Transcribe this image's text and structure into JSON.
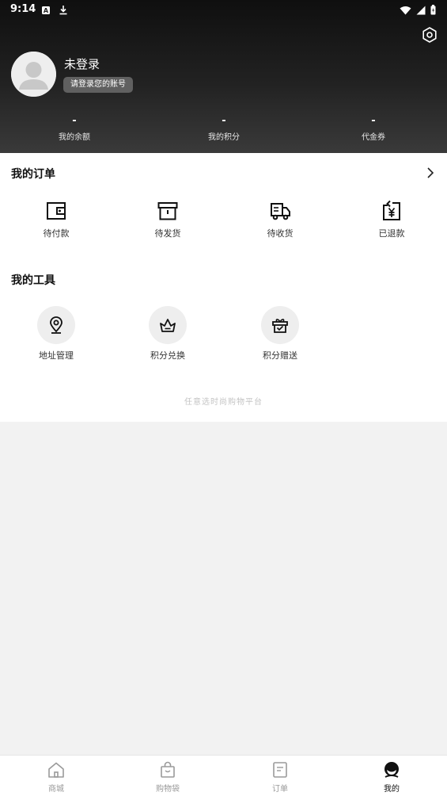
{
  "status_bar": {
    "time": "9:14"
  },
  "profile": {
    "name": "未登录",
    "login_button": "请登录您的账号"
  },
  "stats": [
    {
      "value": "-",
      "label": "我的余额"
    },
    {
      "value": "-",
      "label": "我的积分"
    },
    {
      "value": "-",
      "label": "代金券"
    }
  ],
  "orders": {
    "title": "我的订单",
    "items": [
      {
        "label": "待付款",
        "icon": "wallet-icon"
      },
      {
        "label": "待发货",
        "icon": "box-icon"
      },
      {
        "label": "待收货",
        "icon": "truck-icon"
      },
      {
        "label": "已退款",
        "icon": "refund-icon"
      }
    ]
  },
  "tools": {
    "title": "我的工具",
    "items": [
      {
        "label": "地址管理",
        "icon": "location-pin-icon"
      },
      {
        "label": "积分兑换",
        "icon": "basket-icon"
      },
      {
        "label": "积分赠送",
        "icon": "gift-icon"
      }
    ]
  },
  "footer_note": "任意选时尚购物平台",
  "tabbar": {
    "items": [
      {
        "label": "商城",
        "icon": "home-icon",
        "active": false
      },
      {
        "label": "购物袋",
        "icon": "bag-icon",
        "active": false
      },
      {
        "label": "订单",
        "icon": "document-icon",
        "active": false
      },
      {
        "label": "我的",
        "icon": "profile-face-icon",
        "active": true
      }
    ]
  },
  "colors": {
    "header_dark": "#1a1a1a",
    "active_tab": "#111111",
    "inactive_tab": "#999999"
  }
}
